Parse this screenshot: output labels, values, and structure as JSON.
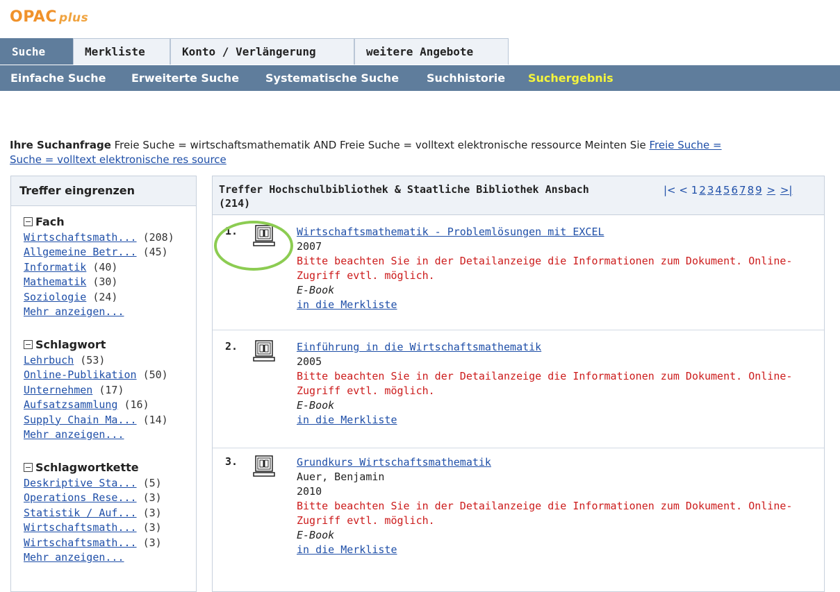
{
  "logo": {
    "main": "OPAC",
    "suffix": "plus"
  },
  "tabs": [
    "Suche",
    "Merkliste",
    "Konto / Verlängerung",
    "weitere Angebote"
  ],
  "subnav": [
    "Einfache Suche",
    "Erweiterte Suche",
    "Systematische Suche",
    "Suchhistorie",
    "Suchergebnis"
  ],
  "query": {
    "label": "Ihre Suchanfrage",
    "text": " Freie Suche = wirtschaftsmathematik AND Freie Suche = volltext elektronische ressource Meinten Sie ",
    "suggestion_part1": " Freie Suche = ",
    "suggestion_part2": "Suche = volltext elektronische res source"
  },
  "sidebar": {
    "title": "Treffer eingrenzen",
    "facets": [
      {
        "title": "Fach",
        "items": [
          {
            "label": "Wirtschaftsmath...",
            "count": "(208)"
          },
          {
            "label": "Allgemeine Betr...",
            "count": "(45)"
          },
          {
            "label": "Informatik",
            "count": "(40)"
          },
          {
            "label": "Mathematik",
            "count": "(30)"
          },
          {
            "label": "Soziologie",
            "count": "(24)"
          }
        ],
        "more": "Mehr anzeigen..."
      },
      {
        "title": "Schlagwort",
        "items": [
          {
            "label": "Lehrbuch",
            "count": "(53)"
          },
          {
            "label": "Online-Publikation",
            "count": "(50)"
          },
          {
            "label": "Unternehmen",
            "count": "(17)"
          },
          {
            "label": "Aufsatzsammlung",
            "count": "(16)"
          },
          {
            "label": "Supply Chain Ma...",
            "count": "(14)"
          }
        ],
        "more": "Mehr anzeigen..."
      },
      {
        "title": "Schlagwortkette",
        "items": [
          {
            "label": "Deskriptive Sta...",
            "count": "(5)"
          },
          {
            "label": "Operations Rese...",
            "count": "(3)"
          },
          {
            "label": "Statistik / Auf...",
            "count": "(3)"
          },
          {
            "label": "Wirtschaftsmath...",
            "count": "(3)"
          },
          {
            "label": "Wirtschaftsmath...",
            "count": "(3)"
          }
        ],
        "more": "Mehr anzeigen..."
      }
    ]
  },
  "results": {
    "title_line1": "Treffer Hochschulbibliothek & Staatliche Bibliothek Ansbach",
    "title_line2": "(214)",
    "pager": {
      "first": "|<",
      "prev": "<",
      "current": "1",
      "pages": [
        "2",
        "3",
        "4",
        "5",
        "6",
        "7",
        "8",
        "9"
      ],
      "next": ">",
      "last": ">|"
    },
    "items": [
      {
        "num": "1.",
        "title": "Wirtschaftsmathematik - Problemlösungen mit EXCEL",
        "author": "",
        "year": "2007",
        "warning": "Bitte beachten Sie in der Detailanzeige die Informationen zum Dokument. Online-Zugriff evtl. möglich.",
        "type": "E-Book",
        "action": "in die Merkliste"
      },
      {
        "num": "2.",
        "title": "Einführung in die Wirtschaftsmathematik",
        "author": "",
        "year": "2005",
        "warning": "Bitte beachten Sie in der Detailanzeige die Informationen zum Dokument. Online-Zugriff evtl. möglich.",
        "type": "E-Book",
        "action": "in die Merkliste"
      },
      {
        "num": "3.",
        "title": "Grundkurs Wirtschaftsmathematik",
        "author": "Auer, Benjamin",
        "year": "2010",
        "warning": "Bitte beachten Sie in der Detailanzeige die Informationen zum Dokument. Online-Zugriff evtl. möglich.",
        "type": "E-Book",
        "action": "in die Merkliste"
      }
    ]
  },
  "colors": {
    "nav": "#5f7d9c",
    "active_subnav": "#f5f53c",
    "link": "#1f4fa8",
    "warning": "#cc1b1b",
    "logo": "#f0922b",
    "highlight": "#8ccc52"
  },
  "icons": {
    "result_type": "ebook-computer-icon",
    "facet_toggle": "collapse-minus-icon"
  }
}
